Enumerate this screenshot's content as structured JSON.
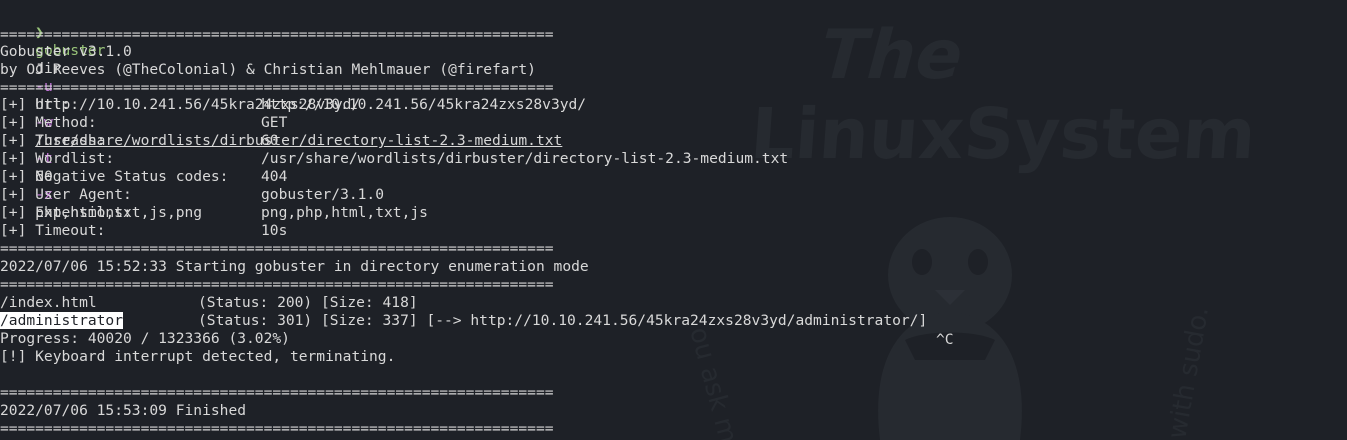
{
  "wallpaper": {
    "logo_line1": "The",
    "logo_line2": "LinuxSystem",
    "arc_left": "ou ask m",
    "arc_right": "with sudo."
  },
  "command": {
    "prompt": "❯",
    "program": "gobuster",
    "subcommand": "dir",
    "flag_u": "-u",
    "url": "http://10.10.241.56/45kra24zxs28v3yd/",
    "flag_w": "-w",
    "wordlist": "/usr/share/wordlists/dirbuster/directory-list-2.3-medium.txt",
    "flag_t": "-t",
    "threads": "60",
    "flag_x": "-x",
    "extensions": "php,html,txt,js,png"
  },
  "separator": "===============================================================",
  "banner": {
    "version": "Gobuster v3.1.0",
    "authors": "by OJ Reeves (@TheColonial) & Christian Mehlmauer (@firefart)"
  },
  "config": [
    {
      "label": "[+] Url:",
      "value": "http://10.10.241.56/45kra24zxs28v3yd/"
    },
    {
      "label": "[+] Method:",
      "value": "GET"
    },
    {
      "label": "[+] Threads:",
      "value": "60"
    },
    {
      "label": "[+] Wordlist:",
      "value": "/usr/share/wordlists/dirbuster/directory-list-2.3-medium.txt"
    },
    {
      "label": "[+] Negative Status codes:",
      "value": "404"
    },
    {
      "label": "[+] User Agent:",
      "value": "gobuster/3.1.0"
    },
    {
      "label": "[+] Extensions:",
      "value": "png,php,html,txt,js"
    },
    {
      "label": "[+] Timeout:",
      "value": "10s"
    }
  ],
  "start_msg": "2022/07/06 15:52:33 Starting gobuster in directory enumeration mode",
  "results": [
    {
      "path": "/index.html",
      "info": "(Status: 200) [Size: 418]"
    },
    {
      "path": "/administrator",
      "info": "(Status: 301) [Size: 337] [--> http://10.10.241.56/45kra24zxs28v3yd/administrator/]"
    }
  ],
  "interrupt_char": "^C",
  "progress": "Progress: 40020 / 1323366 (3.02%)",
  "keyboard_msg": "[!] Keyboard interrupt detected, terminating.",
  "finish_msg": "2022/07/06 15:53:09 Finished"
}
